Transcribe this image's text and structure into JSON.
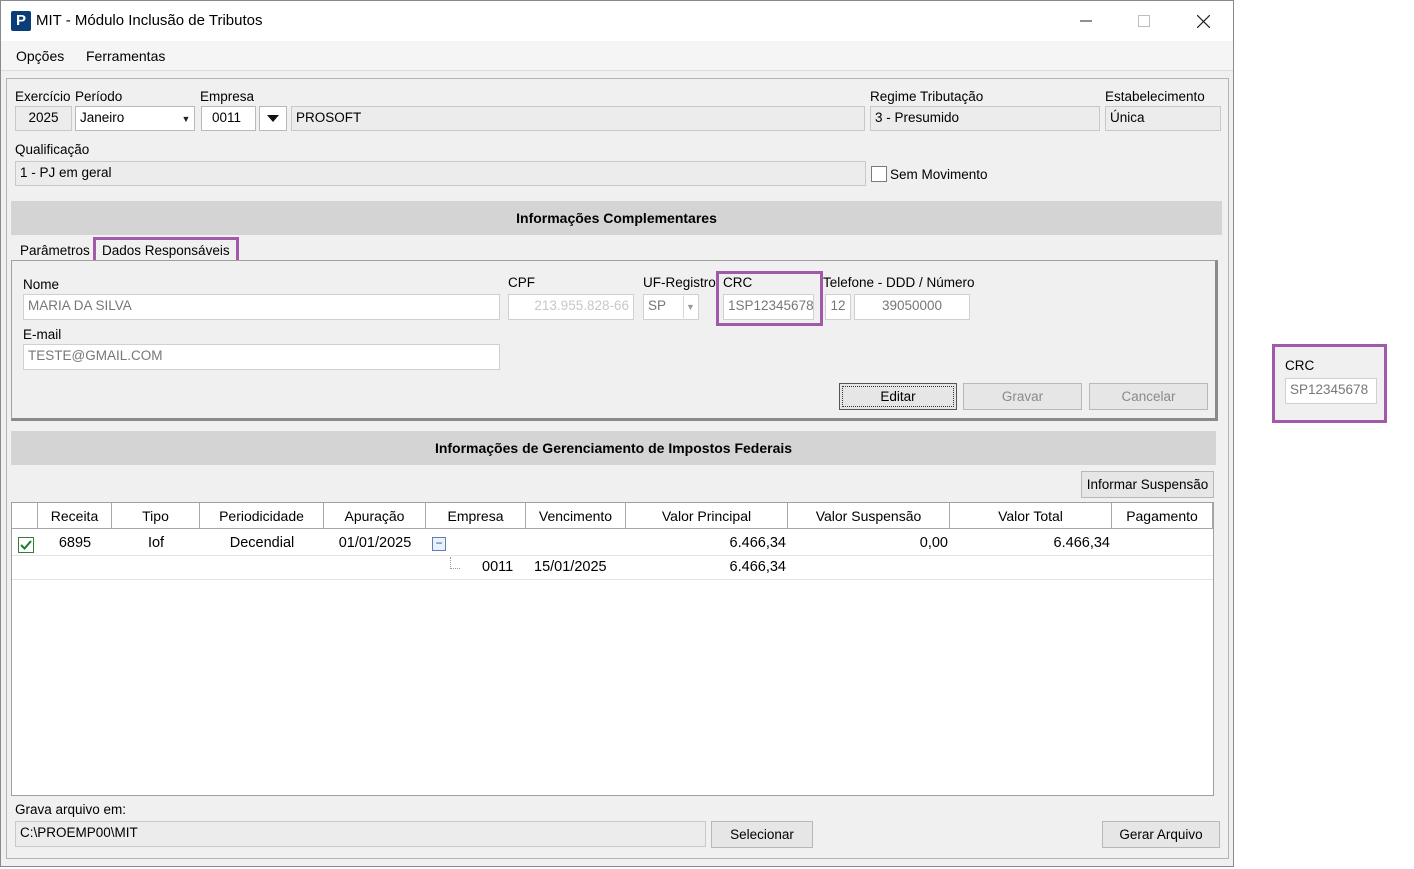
{
  "window": {
    "title": "MIT - Módulo Inclusão de Tributos",
    "minimize_glyph": "—",
    "maximize_glyph": "☐",
    "close_glyph": "✕"
  },
  "app_icon_letter": "P",
  "menu": [
    "Opções",
    "Ferramentas"
  ],
  "header": {
    "exercicio_label": "Exercício",
    "exercicio_value": "2025",
    "periodo_label": "Período",
    "periodo_value": "Janeiro",
    "empresa_label": "Empresa",
    "empresa_code": "0011",
    "empresa_name": "PROSOFT",
    "regime_label": "Regime Tributação",
    "regime_value": "3 - Presumido",
    "estabelecimento_label": "Estabelecimento",
    "estabelecimento_value": "Única",
    "qualificacao_label": "Qualificação",
    "qualificacao_value": "1 - PJ em geral",
    "sem_movimento_label": "Sem Movimento",
    "sem_movimento_checked": false
  },
  "complementares": {
    "title": "Informações Complementares",
    "tabs": [
      "Parâmetros",
      "Dados Responsáveis"
    ],
    "active_tab": "Dados Responsáveis",
    "nome_label": "Nome",
    "nome_value": "MARIA DA SILVA",
    "cpf_label": "CPF",
    "cpf_value": "213.955.828-66",
    "uf_label": "UF-Registro",
    "uf_value": "SP",
    "crc_label": "CRC",
    "crc_value": "1SP12345678",
    "telefone_label": "Telefone - DDD / Número",
    "ddd_value": "12",
    "numero_value": "39050000",
    "email_label": "E-mail",
    "email_value": "TESTE@GMAIL.COM",
    "editar": "Editar",
    "gravar": "Gravar",
    "cancelar": "Cancelar"
  },
  "federais": {
    "title": "Informações de Gerenciamento de Impostos Federais",
    "informar_suspensao": "Informar Suspensão",
    "columns": [
      "Receita",
      "Tipo",
      "Periodicidade",
      "Apuração",
      "Empresa",
      "Vencimento",
      "Valor Principal",
      "Valor Suspensão",
      "Valor Total",
      "Pagamento"
    ],
    "rows": [
      {
        "checked": true,
        "receita": "6895",
        "tipo": "Iof",
        "periodicidade": "Decendial",
        "apuracao": "01/01/2025",
        "valor_principal": "6.466,34",
        "valor_suspensao": "0,00",
        "valor_total": "6.466,34",
        "pagamento": ""
      }
    ],
    "sub_rows": [
      {
        "empresa": "0011",
        "vencimento": "15/01/2025",
        "valor_principal": "6.466,34"
      }
    ],
    "expand_glyph": "−"
  },
  "footer": {
    "grava_label": "Grava arquivo em:",
    "path_value": "C:\\PROEMP00\\MIT",
    "selecionar": "Selecionar",
    "gerar_arquivo": "Gerar Arquivo"
  },
  "callout": {
    "crc_label": "CRC",
    "crc_value": "SP12345678"
  },
  "colors": {
    "highlight": "#a05aa8",
    "section_bar": "#d4d4d4",
    "app_icon": "#0b3d78"
  }
}
